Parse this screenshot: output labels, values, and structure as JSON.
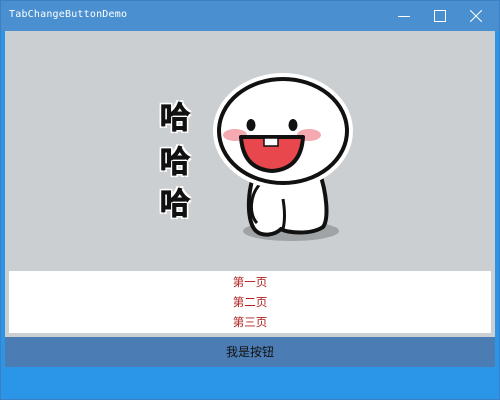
{
  "window": {
    "title": "TabChangeButtonDemo",
    "controls": {
      "minimize_icon": "minimize-icon",
      "maximize_icon": "maximize-icon",
      "close_icon": "close-icon"
    }
  },
  "image": {
    "text_lines": [
      "哈",
      "哈",
      "哈"
    ]
  },
  "tabs": [
    "第一页",
    "第二页",
    "第三页"
  ],
  "button": {
    "label": "我是按钮"
  },
  "colors": {
    "titlebar": "#4a8fd0",
    "content_bg": "#cccfd1",
    "tab_text": "#b02020",
    "button_bg": "#4c7cb4",
    "bottom_strip": "#2b95e7"
  }
}
